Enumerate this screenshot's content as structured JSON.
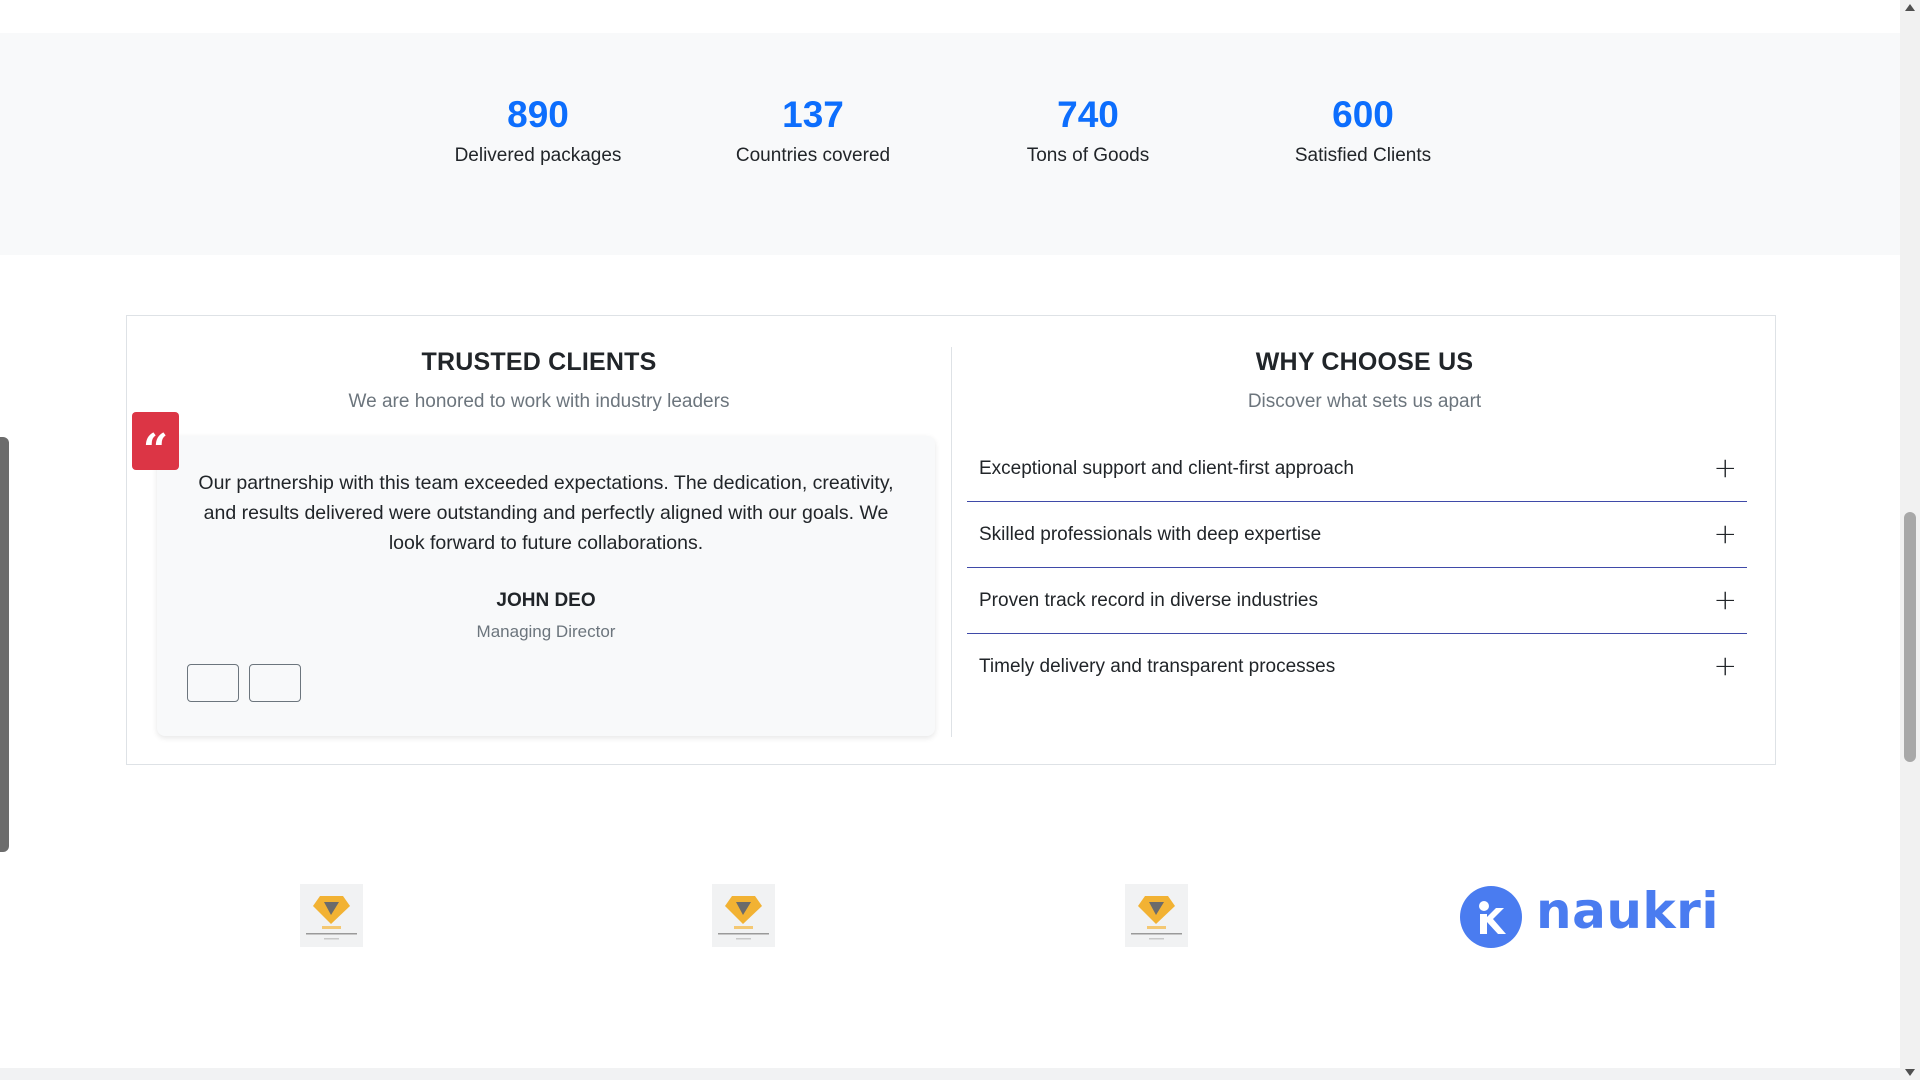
{
  "stats": [
    {
      "number": "890",
      "label": "Delivered packages"
    },
    {
      "number": "137",
      "label": "Countries covered"
    },
    {
      "number": "740",
      "label": "Tons of Goods"
    },
    {
      "number": "600",
      "label": "Satisfied Clients"
    }
  ],
  "trusted": {
    "title": "TRUSTED CLIENTS",
    "subtitle": "We are honored to work with industry leaders",
    "quote_icon": "quote-icon",
    "testimonial": {
      "text": "Our partnership with this team exceeded expectations. The dedication, creativity, and results delivered were outstanding and perfectly aligned with our goals. We look forward to future collaborations.",
      "name": "JOHN DEO",
      "role": "Managing Director"
    }
  },
  "why": {
    "title": "WHY CHOOSE US",
    "subtitle": "Discover what sets us apart",
    "items": [
      "Exceptional support and client-first approach",
      "Skilled professionals with deep expertise",
      "Proven track record in diverse industries",
      "Timely delivery and transparent processes"
    ],
    "toggle_symbol": "+"
  },
  "logos": {
    "brand_text": "naukri"
  },
  "colors": {
    "accent": "#0d6efd",
    "quote_badge": "#dc3545",
    "accordion_border": "#3f4aa8",
    "naukri_blue": "#4a7cf0"
  }
}
